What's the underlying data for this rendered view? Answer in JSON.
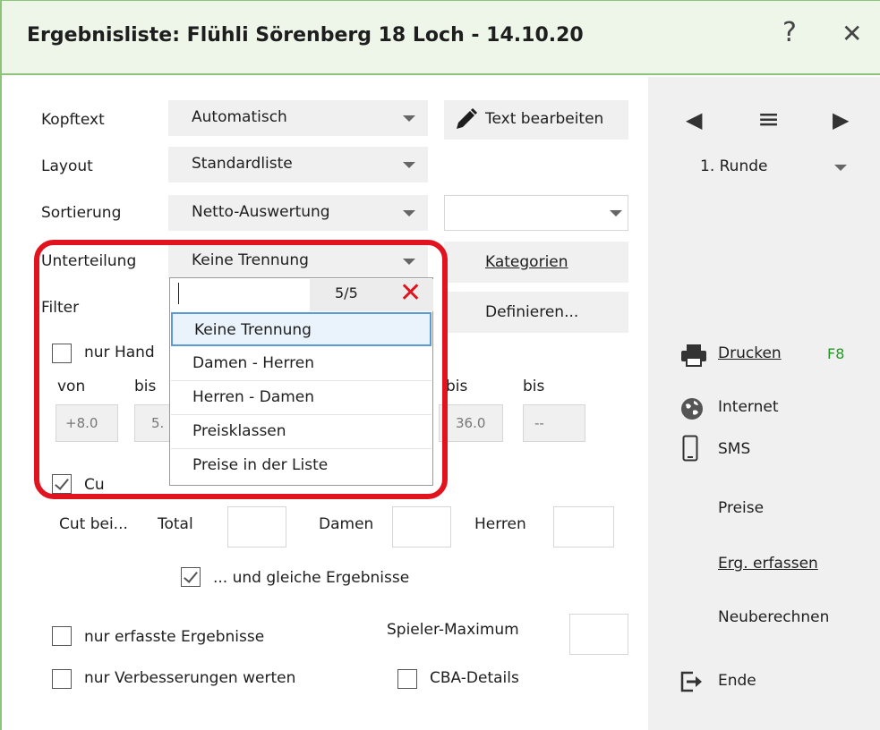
{
  "window": {
    "title": "Ergebnisliste: Flühli Sörenberg 18 Loch - 14.10.20",
    "help_glyph": "?",
    "close_glyph": "✕"
  },
  "form": {
    "kopftext_label": "Kopftext",
    "kopftext_value": "Automatisch",
    "text_bearbeiten_label": "Text bearbeiten",
    "layout_label": "Layout",
    "layout_value": "Standardliste",
    "sortierung_label": "Sortierung",
    "sortierung_value": "Netto-Auswertung",
    "sortierung2_value": "",
    "unterteilung_label": "Unterteilung",
    "unterteilung_value": "Keine Trennung",
    "kategorien_label": "Kategorien",
    "filter_label": "Filter",
    "definieren_label": "Definieren...",
    "nur_hand_label": "nur Hand",
    "von_label": "von",
    "bis1_label": "bis",
    "bis2_label": "bis",
    "bis3_label": "bis",
    "hcp_from": "+8.0",
    "hcp_to": "5.",
    "val_36": "36.0",
    "val_dash": "--",
    "cut_short_label": "Cu",
    "cut_bei_label": "Cut bei...",
    "total_label": "Total",
    "damen_label": "Damen",
    "herren_label": "Herren",
    "gleiche_label": "... und gleiche Ergebnisse",
    "nur_erfasste_label": "nur erfasste Ergebnisse",
    "spieler_max_label": "Spieler-Maximum",
    "nur_verbesserungen_label": "nur Verbesserungen werten",
    "cba_label": "CBA-Details"
  },
  "dropdown": {
    "search_value": "",
    "count": "5/5",
    "clear_glyph": "✕",
    "options": [
      "Keine Trennung",
      "Damen - Herren",
      "Herren - Damen",
      "Preisklassen",
      "Preise in der Liste"
    ],
    "selected": "Keine Trennung"
  },
  "right_panel": {
    "prev_glyph": "◀",
    "menu_glyph": "≡",
    "next_glyph": "▶",
    "runde_value": "1. Runde",
    "drucken_label": "Drucken",
    "drucken_shortcut": "F8",
    "internet_label": "Internet",
    "sms_label": "SMS",
    "preise_label": "Preise",
    "erg_erfassen_label": "Erg. erfassen",
    "neuberechnen_label": "Neuberechnen",
    "ende_label": "Ende"
  },
  "colors": {
    "title_bg": "#eef6e9",
    "accent_green": "#8cc47a",
    "highlight_red": "#e0131f",
    "shortcut_green": "#1f9a1f"
  }
}
